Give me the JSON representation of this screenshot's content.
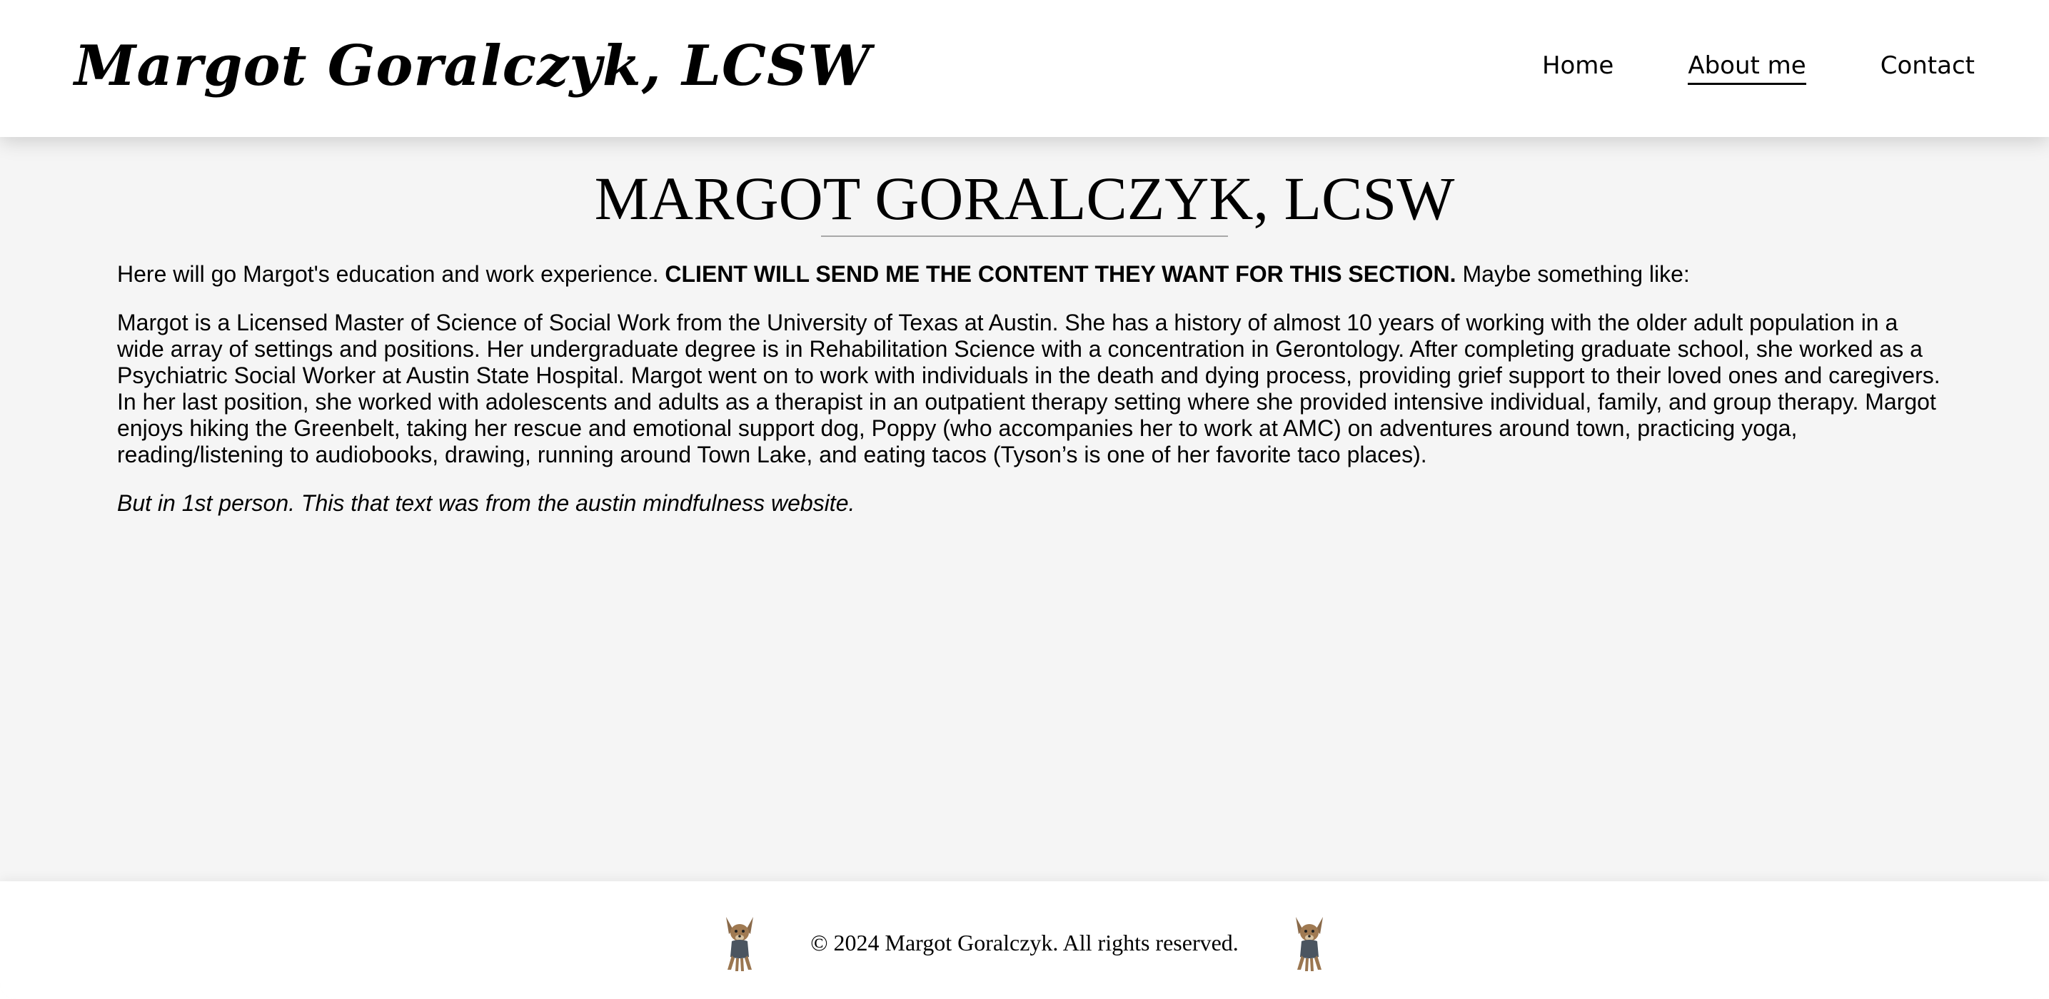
{
  "header": {
    "brand": "Margot Goralczyk, LCSW",
    "nav": [
      {
        "label": "Home",
        "active": false
      },
      {
        "label": "About me",
        "active": true
      },
      {
        "label": "Contact",
        "active": false
      }
    ]
  },
  "main": {
    "title": "MARGOT GORALCZYK, LCSW",
    "intro": {
      "before": "Here will go Margot's education and work experience. ",
      "bold": "CLIENT WILL SEND ME THE CONTENT THEY WANT FOR THIS SECTION.",
      "after": " Maybe something like:"
    },
    "bio": "Margot is a Licensed Master of Science of Social Work from the University of Texas at Austin. She has a history of almost 10 years of working with the older adult population in a wide array of settings and positions. Her undergraduate degree is in Rehabilitation Science with a concentration in Gerontology. After completing graduate school, she worked as a Psychiatric Social Worker at Austin State Hospital. Margot went on to work with individuals in the death and dying process, providing grief support to their loved ones and caregivers. In her last position, she worked with adolescents and adults as a therapist in an outpatient therapy setting where she provided intensive individual, family, and group therapy. Margot enjoys hiking the Greenbelt, taking her rescue and emotional support dog, Poppy (who accompanies her to work at AMC) on adventures around town, practicing yoga, reading/listening to audiobooks, drawing, running around Town Lake, and eating tacos (Tyson’s is one of her favorite taco places).",
    "note": "But in 1st person. This that text was from the austin mindfulness website."
  },
  "footer": {
    "copyright": "© 2024 Margot Goralczyk. All rights reserved.",
    "left_icon": "dog-icon",
    "right_icon": "dog-icon"
  },
  "colors": {
    "background": "#f5f5f5",
    "header_bg": "#ffffff",
    "text": "#000000",
    "rule": "#a8a8a8"
  }
}
